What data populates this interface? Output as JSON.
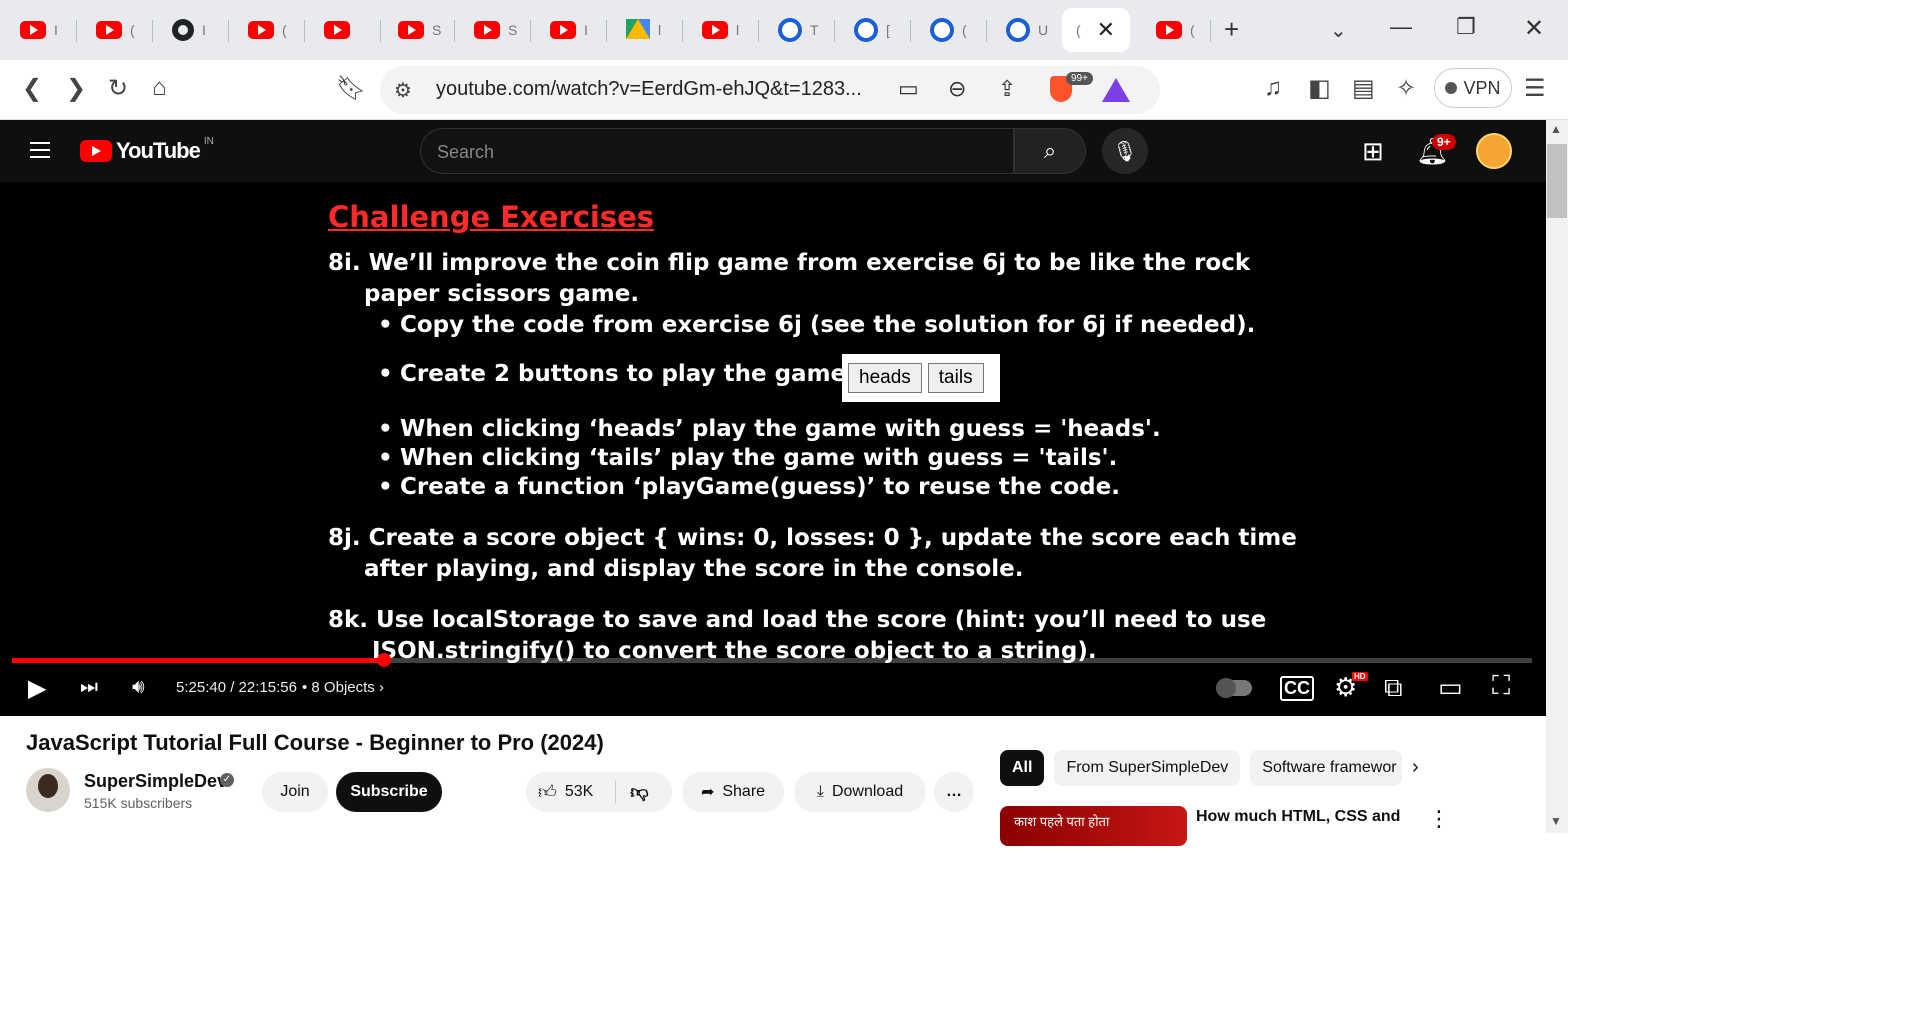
{
  "browser": {
    "tabs": [
      {
        "icon": "youtube-icon",
        "label": "I"
      },
      {
        "icon": "youtube-icon",
        "label": "("
      },
      {
        "icon": "github-icon",
        "label": "I"
      },
      {
        "icon": "youtube-icon",
        "label": "("
      },
      {
        "icon": "youtube-icon",
        "label": ""
      },
      {
        "icon": "youtube-icon",
        "label": "S"
      },
      {
        "icon": "youtube-icon",
        "label": "S"
      },
      {
        "icon": "youtube-icon",
        "label": "I"
      },
      {
        "icon": "google-drive-icon",
        "label": "l"
      },
      {
        "icon": "youtube-icon",
        "label": "l"
      },
      {
        "icon": "c-icon",
        "label": "T"
      },
      {
        "icon": "c-icon",
        "label": "["
      },
      {
        "icon": "c-icon",
        "label": "("
      },
      {
        "icon": "c-icon",
        "label": "U"
      },
      {
        "icon": "",
        "label": "(",
        "active": true
      },
      {
        "icon": "youtube-icon",
        "label": "("
      }
    ],
    "url": "youtube.com/watch?v=EerdGm-ehJQ&t=1283...",
    "shields_badge": "99+",
    "vpn_label": "VPN"
  },
  "youtube": {
    "logo_text": "YouTube",
    "country_code": "IN",
    "search_placeholder": "Search",
    "notification_count": "9+"
  },
  "slide": {
    "title": "Challenge Exercises",
    "lines": [
      "8i. We’ll improve the coin flip game from exercise 6j to be like the rock",
      "paper scissors game.",
      "Copy the code from exercise 6j (see the solution for 6j if needed).",
      "Create 2 buttons to play the game",
      "When clicking ‘heads’ play the game with guess = 'heads'.",
      "When clicking ‘tails’ play the game with guess = 'tails'.",
      "Create a function ‘playGame(guess)’ to reuse the code.",
      "8j. Create a score object { wins: 0, losses: 0 }, update the score each time",
      "after playing, and display the score in the console.",
      "8k. Use localStorage to save and load the score (hint: you’ll need to use",
      "JSON.stringify() to convert the score object to a string)."
    ],
    "demo_buttons": [
      "heads",
      "tails"
    ]
  },
  "player": {
    "current_time": "5:25:40",
    "duration": "22:15:56",
    "time_display": "5:25:40 / 22:15:56",
    "chapter": "• 8 Objects",
    "progress_fraction": 0.245,
    "hd_badge": "HD"
  },
  "video": {
    "title": "JavaScript Tutorial Full Course - Beginner to Pro (2024)",
    "channel_name": "SuperSimpleDev",
    "subscribers": "515K subscribers",
    "join_label": "Join",
    "subscribe_label": "Subscribe",
    "likes": "53K",
    "share_label": "Share",
    "download_label": "Download"
  },
  "sidebar": {
    "chips": [
      "All",
      "From SuperSimpleDev",
      "Software framewor"
    ],
    "rec_thumb_text": "काश पहले पता होता",
    "rec_title": "How much HTML, CSS and"
  },
  "colors": {
    "youtube_red": "#ff0000",
    "slide_title": "#ff2a2a",
    "yt_dark": "#0f0f0f"
  }
}
